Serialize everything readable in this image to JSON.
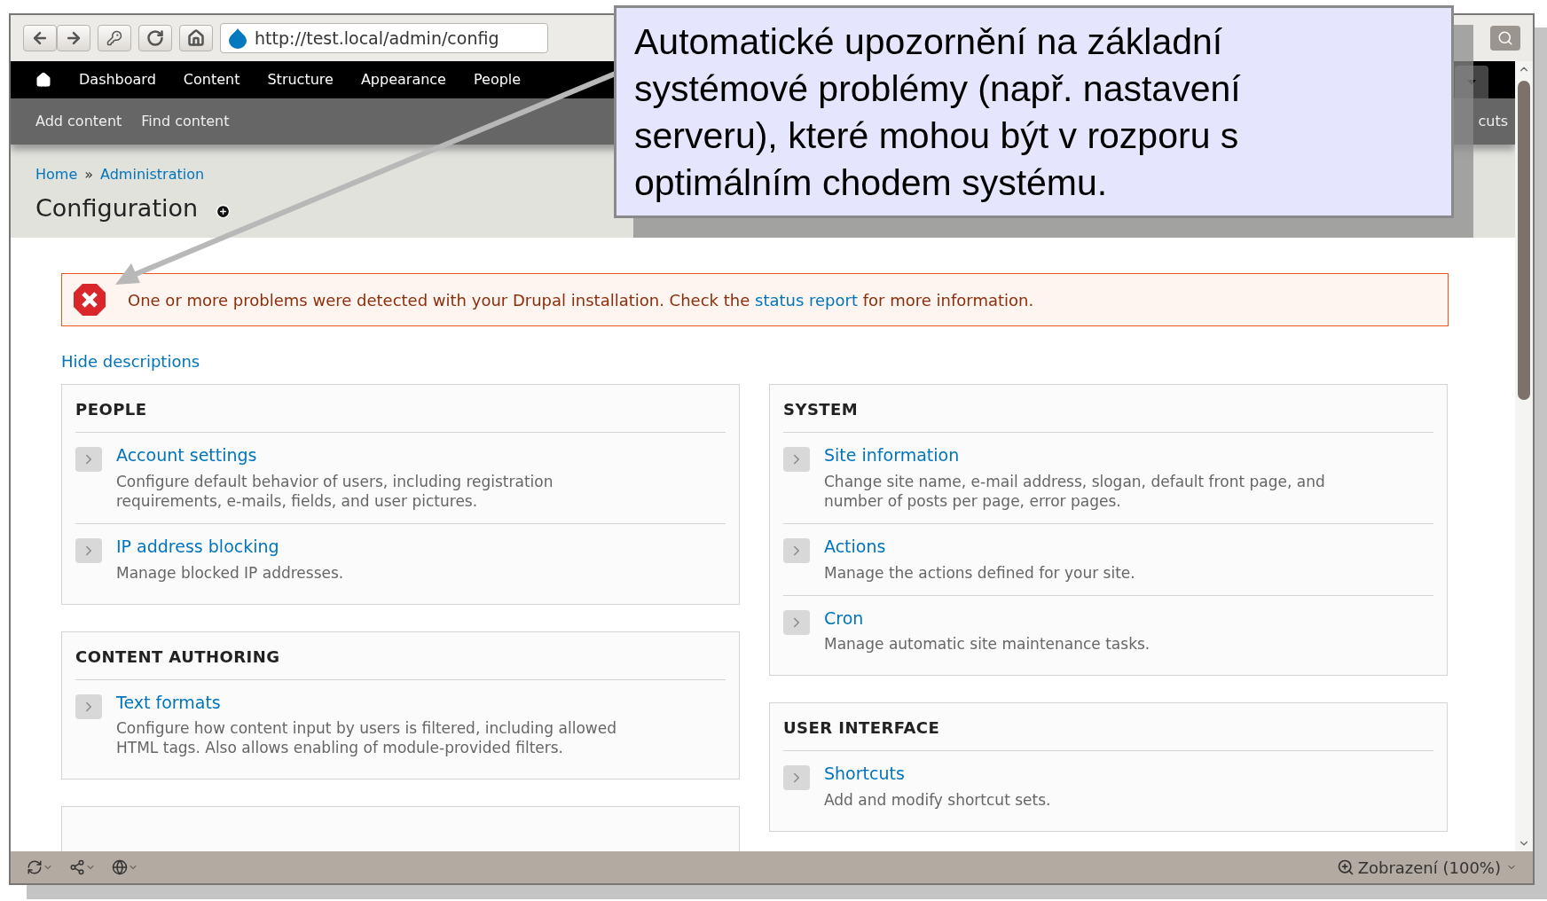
{
  "browser": {
    "url": "http://test.local/admin/config"
  },
  "nav": {
    "items": [
      "Dashboard",
      "Content",
      "Structure",
      "Appearance",
      "People"
    ]
  },
  "secondary": {
    "links": [
      "Add content",
      "Find content"
    ],
    "right_text": "cuts"
  },
  "breadcrumb": {
    "items": [
      "Home",
      "Administration"
    ],
    "separator": "»"
  },
  "title": "Configuration",
  "message": {
    "text_before": "One or more problems were detected with your Drupal installation. Check the",
    "link": "status report",
    "text_after": "for more information."
  },
  "hide_descriptions": "Hide descriptions",
  "columns": [
    [
      {
        "title": "PEOPLE",
        "items": [
          {
            "title": "Account settings",
            "description": "Configure default behavior of users, including registration requirements, e-mails, fields, and user pictures."
          },
          {
            "title": "IP address blocking",
            "description": "Manage blocked IP addresses."
          }
        ]
      },
      {
        "title": "CONTENT AUTHORING",
        "items": [
          {
            "title": "Text formats",
            "description": "Configure how content input by users is filtered, including allowed HTML tags. Also allows enabling of module-provided filters."
          }
        ]
      }
    ],
    [
      {
        "title": "SYSTEM",
        "items": [
          {
            "title": "Site information",
            "description": "Change site name, e-mail address, slogan, default front page, and number of posts per page, error pages."
          },
          {
            "title": "Actions",
            "description": "Manage the actions defined for your site."
          },
          {
            "title": "Cron",
            "description": "Manage automatic site maintenance tasks."
          }
        ]
      },
      {
        "title": "USER INTERFACE",
        "items": [
          {
            "title": "Shortcuts",
            "description": "Add and modify shortcut sets."
          }
        ]
      }
    ]
  ],
  "status_bar": {
    "zoom": "Zobrazení (100%)"
  },
  "callout": {
    "text": "Automatické upozornění na základní systémové problémy (např. nastavení serveru), které mohou být v rozporu s optimálním chodem systému."
  }
}
